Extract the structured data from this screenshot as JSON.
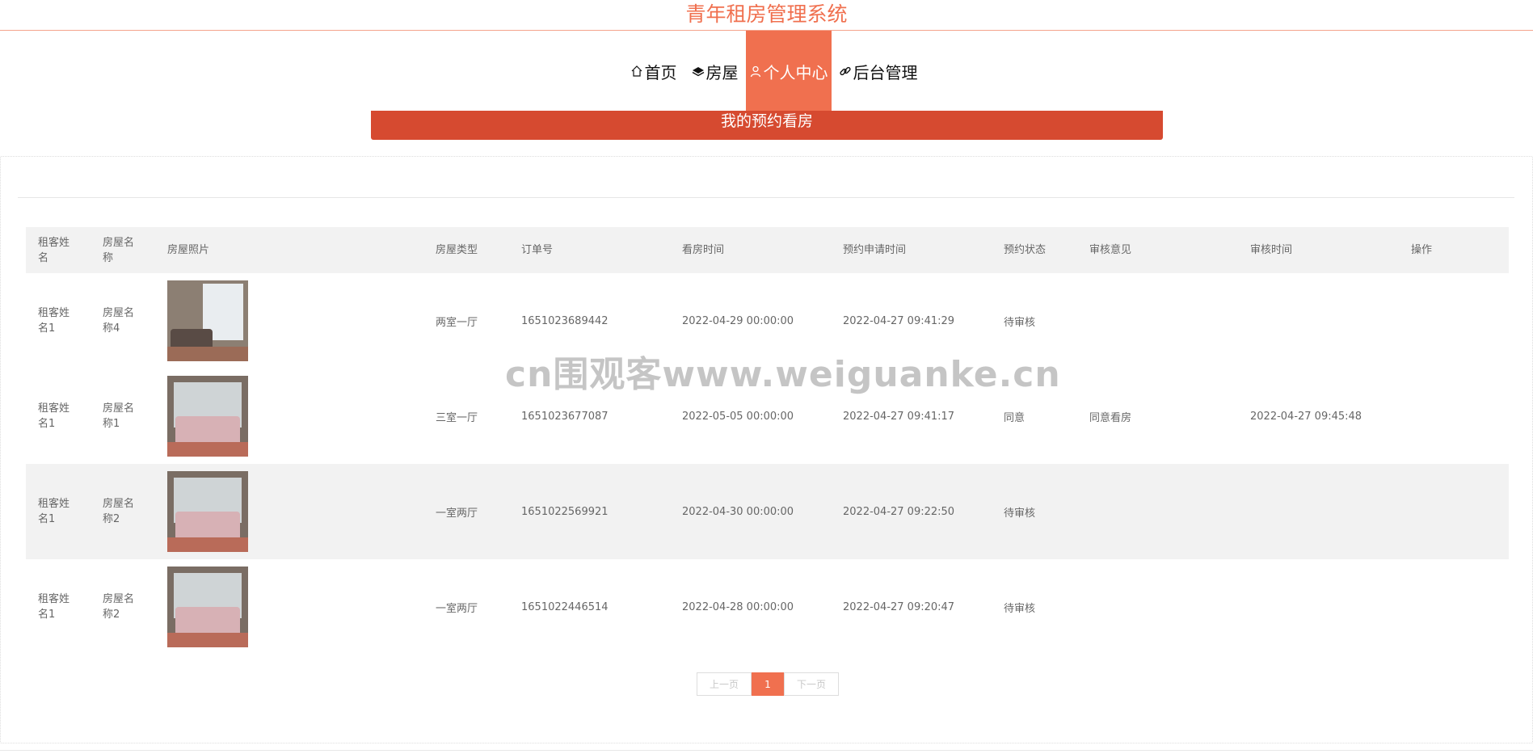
{
  "site": {
    "title": "青年租房管理系统"
  },
  "nav": [
    {
      "label": "首页",
      "icon": "home-icon"
    },
    {
      "label": "房屋",
      "icon": "layers-icon"
    },
    {
      "label": "个人中心",
      "icon": "user-icon",
      "active": true
    },
    {
      "label": "后台管理",
      "icon": "link-icon"
    }
  ],
  "banner": {
    "title": "我的预约看房"
  },
  "table": {
    "headers": [
      "租客姓名",
      "房屋名称",
      "房屋照片",
      "房屋类型",
      "订单号",
      "看房时间",
      "预约申请时间",
      "预约状态",
      "审核意见",
      "审核时间",
      "操作"
    ],
    "rows": [
      {
        "tenant": "租客姓名1",
        "house": "房屋名称4",
        "type": "两室一厅",
        "order": "1651023689442",
        "view_time": "2022-04-29 00:00:00",
        "apply_time": "2022-04-27 09:41:29",
        "status": "待审核",
        "opinion": "",
        "review_time": ""
      },
      {
        "tenant": "租客姓名1",
        "house": "房屋名称1",
        "type": "三室一厅",
        "order": "1651023677087",
        "view_time": "2022-05-05 00:00:00",
        "apply_time": "2022-04-27 09:41:17",
        "status": "同意",
        "opinion": "同意看房",
        "review_time": "2022-04-27 09:45:48"
      },
      {
        "tenant": "租客姓名1",
        "house": "房屋名称2",
        "type": "一室两厅",
        "order": "1651022569921",
        "view_time": "2022-04-30 00:00:00",
        "apply_time": "2022-04-27 09:22:50",
        "status": "待审核",
        "opinion": "",
        "review_time": ""
      },
      {
        "tenant": "租客姓名1",
        "house": "房屋名称2",
        "type": "一室两厅",
        "order": "1651022446514",
        "view_time": "2022-04-28 00:00:00",
        "apply_time": "2022-04-27 09:20:47",
        "status": "待审核",
        "opinion": "",
        "review_time": ""
      }
    ]
  },
  "pager": {
    "prev": "上一页",
    "current": "1",
    "next": "下一页"
  },
  "watermark": "cn围观客www.weiguanke.cn",
  "colors": {
    "accent": "#f0704f",
    "banner": "#d64a30"
  }
}
